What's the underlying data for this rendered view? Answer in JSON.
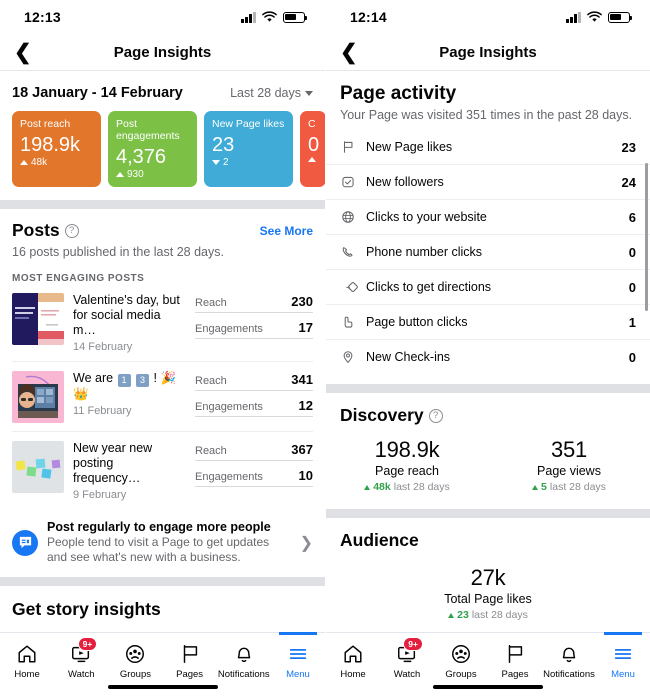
{
  "left": {
    "status": {
      "time": "12:13",
      "signal_icon": "cellular-bars-icon",
      "wifi_icon": "wifi-icon",
      "battery_icon": "battery-icon"
    },
    "nav": {
      "back_icon": "chevron-left-icon",
      "title": "Page Insights"
    },
    "date": {
      "range": "18 January - 14 February",
      "picker_label": "Last 28 days",
      "picker_icon": "chevron-down-icon"
    },
    "cards": [
      {
        "label": "Post reach",
        "value": "198.9k",
        "delta": "48k",
        "direction": "up",
        "color": "#e2762a"
      },
      {
        "label": "Post engagements",
        "value": "4,376",
        "delta": "930",
        "direction": "up",
        "color": "#7cc045"
      },
      {
        "label": "New Page likes",
        "value": "23",
        "delta": "2",
        "direction": "down",
        "color": "#3fabd6"
      },
      {
        "label": "C",
        "value": "0",
        "delta": "",
        "direction": "up",
        "color": "#f05a40"
      }
    ],
    "posts_section": {
      "title": "Posts",
      "help_icon": "question-mark-icon",
      "see_more": "See More",
      "subtitle": "16 posts published in the last 28 days.",
      "group_label": "MOST ENGAGING POSTS",
      "stat_keys": {
        "reach": "Reach",
        "engagements": "Engagements"
      },
      "posts": [
        {
          "title": "Valentine's day, but for social media m…",
          "date": "14 February",
          "reach": "230",
          "engagements": "17",
          "thumb": "valentines-post-thumbnail"
        },
        {
          "title_prefix": "We are",
          "emoji1": "1",
          "emoji2": "3",
          "title_suffix": "!",
          "title_plain": "We are 1 3 ! 🎊 👑",
          "date": "11 February",
          "reach": "341",
          "engagements": "12",
          "thumb": "team-photo-thumbnail"
        },
        {
          "title": "New year new posting frequency…",
          "date": "9 February",
          "reach": "367",
          "engagements": "10",
          "thumb": "sticky-notes-thumbnail"
        }
      ]
    },
    "tip": {
      "icon": "message-bubble-icon",
      "title": "Post regularly to engage more people",
      "subtitle": "People tend to visit a Page to get updates and see what's new with a business.",
      "chevron_icon": "chevron-right-icon"
    },
    "story_title": "Get story insights"
  },
  "right": {
    "status": {
      "time": "12:14",
      "signal_icon": "cellular-bars-icon",
      "wifi_icon": "wifi-icon",
      "battery_icon": "battery-icon"
    },
    "nav": {
      "back_icon": "chevron-left-icon",
      "title": "Page Insights"
    },
    "page_activity": {
      "title": "Page activity",
      "subtitle": "Your Page was visited 351 times in the past 28 days.",
      "rows": [
        {
          "icon": "flag-icon",
          "label": "New Page likes",
          "value": "23"
        },
        {
          "icon": "check-badge-icon",
          "label": "New followers",
          "value": "24"
        },
        {
          "icon": "globe-icon",
          "label": "Clicks to your website",
          "value": "6"
        },
        {
          "icon": "phone-icon",
          "label": "Phone number clicks",
          "value": "0"
        },
        {
          "icon": "directions-icon",
          "label": "Clicks to get directions",
          "value": "0"
        },
        {
          "icon": "tap-hand-icon",
          "label": "Page button clicks",
          "value": "1"
        },
        {
          "icon": "location-pin-icon",
          "label": "New Check-ins",
          "value": "0"
        }
      ]
    },
    "discovery": {
      "title": "Discovery",
      "help_icon": "question-mark-icon",
      "kpis": [
        {
          "number": "198.9k",
          "label": "Page reach",
          "delta": "48k",
          "period": "last 28 days"
        },
        {
          "number": "351",
          "label": "Page views",
          "delta": "5",
          "period": "last 28 days"
        }
      ]
    },
    "audience": {
      "title": "Audience",
      "kpis": [
        {
          "number": "27k",
          "label": "Total Page likes",
          "delta": "23",
          "period": "last 28 days"
        }
      ]
    },
    "scrollbar": "vertical-scrollbar"
  },
  "tabbar": {
    "items": [
      {
        "label": "Home",
        "icon": "home-icon",
        "badge": "",
        "active": false
      },
      {
        "label": "Watch",
        "icon": "watch-video-icon",
        "badge": "9+",
        "active": false
      },
      {
        "label": "Groups",
        "icon": "groups-icon",
        "badge": "",
        "active": false
      },
      {
        "label": "Pages",
        "icon": "pages-flag-icon",
        "badge": "",
        "active": false
      },
      {
        "label": "Notifications",
        "icon": "bell-icon",
        "badge": "",
        "active": false
      },
      {
        "label": "Menu",
        "icon": "hamburger-menu-icon",
        "badge": "",
        "active": true
      }
    ],
    "accent_color": "#1877f2",
    "badge_color": "#e41e3f"
  }
}
